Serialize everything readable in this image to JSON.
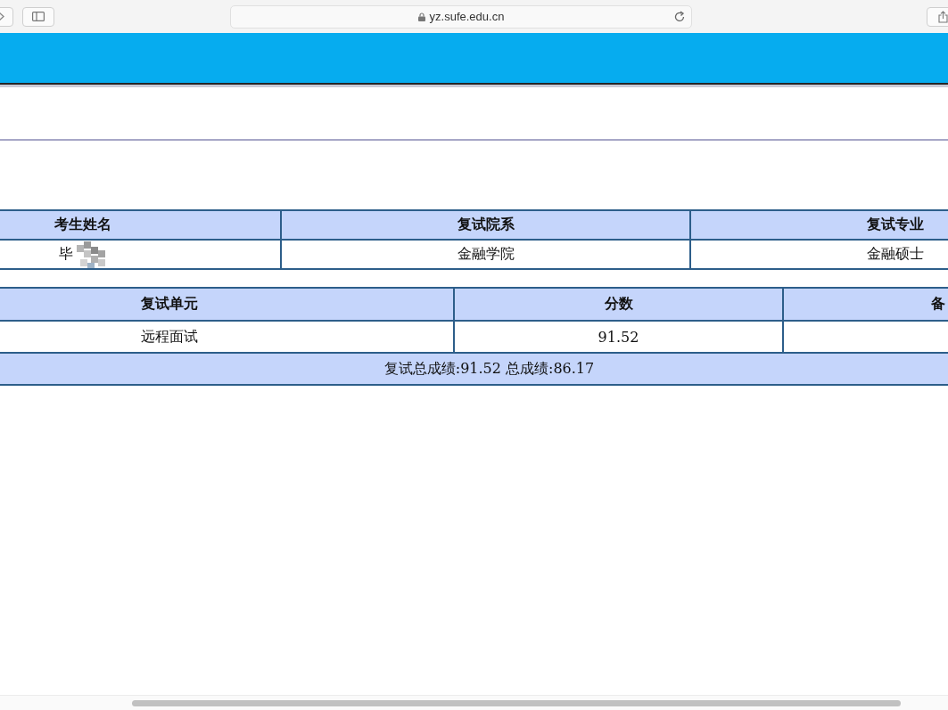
{
  "browser": {
    "address": "yz.sufe.edu.cn"
  },
  "info_table": {
    "columns": [
      "考生姓名",
      "复试院系",
      "复试专业"
    ],
    "rows": [
      {
        "cells": [
          {
            "text": "毕",
            "blurred": true
          },
          {
            "text": "金融学院",
            "blurred": false
          },
          {
            "text": "金融硕士",
            "blurred": false
          }
        ]
      }
    ]
  },
  "score_table": {
    "columns": [
      "复试单元",
      "分数",
      "备"
    ],
    "rows": [
      {
        "cells": [
          "远程面试",
          "91.52"
        ]
      }
    ],
    "summary": "复试总成绩:91.52 总成绩:86.17"
  }
}
